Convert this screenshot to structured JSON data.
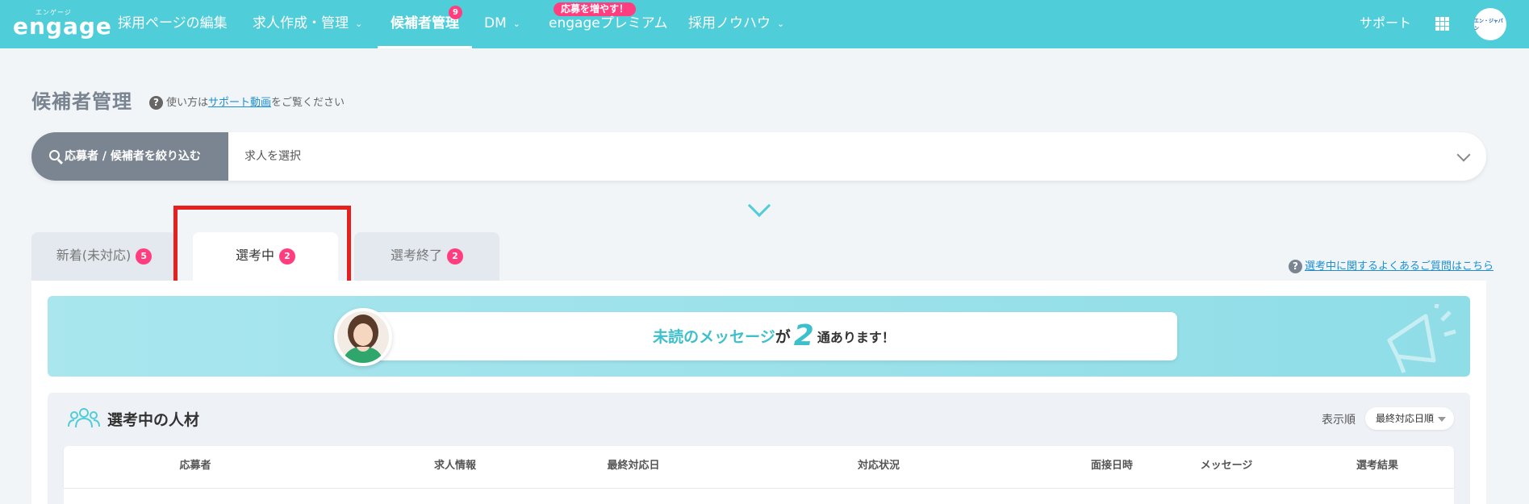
{
  "header": {
    "logo_ruby": "エンゲージ",
    "logo_text": "engage",
    "nav": [
      {
        "label": "採用ページの編集"
      },
      {
        "label": "求人作成・管理",
        "chevron": true
      },
      {
        "label": "候補者管理",
        "active": true,
        "badge": "9"
      },
      {
        "label": "DM",
        "chevron": true
      },
      {
        "label": "engageプレミアム",
        "promo": "応募を増やす！"
      },
      {
        "label": "採用ノウハウ",
        "chevron": true
      }
    ],
    "support": "サポート",
    "account_logo": "エン・ジャパン"
  },
  "page": {
    "title": "候補者管理",
    "help_prefix": "使い方は",
    "help_link": "サポート動画",
    "help_suffix": "をご覧ください"
  },
  "filter": {
    "button_label": "応募者 / 候補者を絞り込む",
    "select_placeholder": "求人を選択"
  },
  "tabs": [
    {
      "label": "新着(未対応)",
      "count": "5"
    },
    {
      "label": "選考中",
      "count": "2",
      "active": true
    },
    {
      "label": "選考終了",
      "count": "2"
    }
  ],
  "faq_link": "選考中に関するよくあるご質問はこちら",
  "message_banner": {
    "highlight": "未読のメッセージ",
    "mid": "が",
    "count": "2",
    "suffix": "通あります！"
  },
  "candidates": {
    "title": "選考中の人材",
    "sort_label": "表示順",
    "sort_value": "最終対応日順",
    "columns": [
      "応募者",
      "求人情報",
      "最終対応日",
      "対応状況",
      "面接日時",
      "メッセージ",
      "選考結果"
    ]
  },
  "colors": {
    "brand": "#4fcdd9",
    "badge": "#ff3d7f",
    "highlight_box": "#e6201f"
  }
}
